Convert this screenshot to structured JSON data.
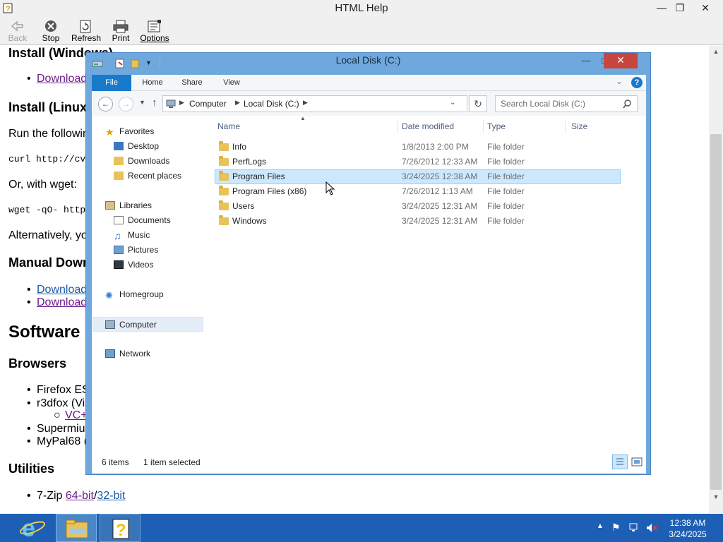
{
  "app": {
    "title": "HTML Help"
  },
  "titlebar": {
    "minimize": "—",
    "restore": "❐",
    "close": "✕"
  },
  "toolbar": {
    "back": "Back",
    "stop": "Stop",
    "refresh": "Refresh",
    "print": "Print",
    "options": "Options"
  },
  "help": {
    "h_install_windows": "Install (Windows)",
    "download_1": "Download",
    "h_install_linux": "Install (Linux",
    "run_following": "Run the following",
    "curl_cmd": "curl http://cv",
    "or_wget": "Or, with wget:",
    "wget_cmd": "wget -qO- http",
    "alternatively": "Alternatively, you",
    "h_manual": "Manual Down",
    "download_2": "Download",
    "download_3": "Download",
    "h_software": "Software",
    "h_browsers": "Browsers",
    "firefox": "Firefox ES",
    "r3dfox": "r3dfox (Vis",
    "vc_link": "VC+",
    "supermium": "Supermiu",
    "mypal": "MyPal68 (",
    "h_utilities": "Utilities",
    "zip_prefix": "7-Zip ",
    "zip_64": "64-bit",
    "zip_sep": "/",
    "zip_32": "32-bit"
  },
  "explorer": {
    "title": "Local Disk (C:)",
    "ribbon_tabs": [
      "File",
      "Home",
      "Share",
      "View"
    ],
    "address": {
      "computer": "Computer",
      "drive": "Local Disk (C:)"
    },
    "search_placeholder": "Search Local Disk (C:)",
    "nav": {
      "favorites": "Favorites",
      "desktop": "Desktop",
      "downloads": "Downloads",
      "recent": "Recent places",
      "libraries": "Libraries",
      "documents": "Documents",
      "music": "Music",
      "pictures": "Pictures",
      "videos": "Videos",
      "homegroup": "Homegroup",
      "computer": "Computer",
      "network": "Network"
    },
    "columns": {
      "name": "Name",
      "date": "Date modified",
      "type": "Type",
      "size": "Size"
    },
    "files": [
      {
        "name": "Info",
        "date": "1/8/2013 2:00 PM",
        "type": "File folder"
      },
      {
        "name": "PerfLogs",
        "date": "7/26/2012 12:33 AM",
        "type": "File folder"
      },
      {
        "name": "Program Files",
        "date": "3/24/2025 12:38 AM",
        "type": "File folder"
      },
      {
        "name": "Program Files (x86)",
        "date": "7/26/2012 1:13 AM",
        "type": "File folder"
      },
      {
        "name": "Users",
        "date": "3/24/2025 12:31 AM",
        "type": "File folder"
      },
      {
        "name": "Windows",
        "date": "3/24/2025 12:31 AM",
        "type": "File folder"
      }
    ],
    "status": {
      "items": "6 items",
      "selected": "1 item selected"
    }
  },
  "taskbar": {
    "time": "12:38 AM",
    "date": "3/24/2025"
  },
  "colors": {
    "accent": "#1979ca",
    "selection": "#cce8ff",
    "taskbar": "#1d5fb4",
    "close": "#c7463e"
  }
}
